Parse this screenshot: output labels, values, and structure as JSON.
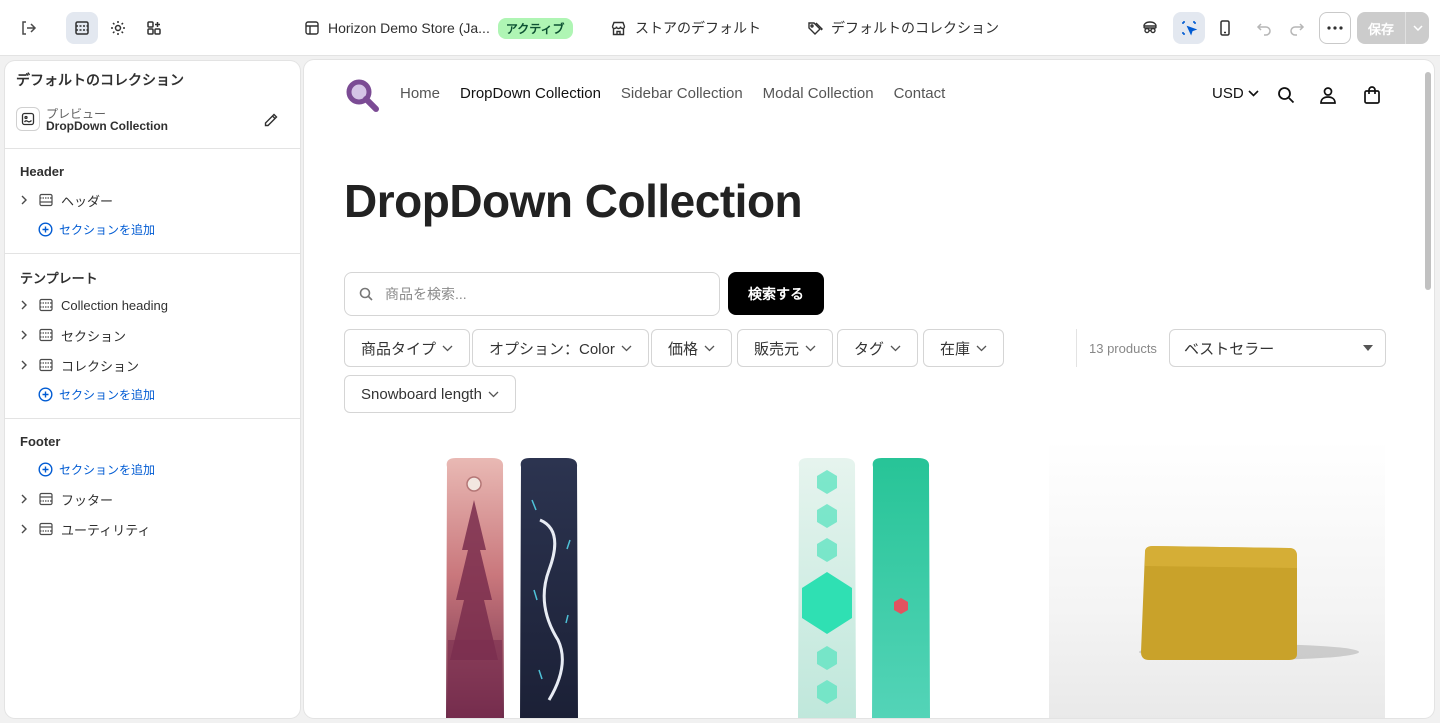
{
  "topbar": {
    "store_name": "Horizon Demo Store (Ja...",
    "store_status": "アクティブ",
    "store_default": "ストアのデフォルト",
    "collection_default": "デフォルトのコレクション",
    "save_label": "保存",
    "icons": [
      "exit-icon",
      "sections-icon",
      "gear-icon",
      "apps-icon",
      "inspect-icon",
      "selection-icon",
      "mobile-icon",
      "undo-icon",
      "redo-icon",
      "more-icon"
    ]
  },
  "sidebar": {
    "title": "デフォルトのコレクション",
    "preview_label": "プレビュー",
    "preview_value": "DropDown Collection",
    "header_group": {
      "title": "Header",
      "items": [
        "ヘッダー"
      ],
      "add_label": "セクションを追加"
    },
    "template_group": {
      "title": "テンプレート",
      "items": [
        "Collection heading",
        "セクション",
        "コレクション"
      ],
      "add_label": "セクションを追加"
    },
    "footer_group": {
      "title": "Footer",
      "add_label": "セクションを追加",
      "items": [
        "フッター",
        "ユーティリティ"
      ]
    }
  },
  "storefront": {
    "nav": [
      "Home",
      "DropDown Collection",
      "Sidebar Collection",
      "Modal Collection",
      "Contact"
    ],
    "currency": "USD",
    "page_title": "DropDown Collection",
    "search_placeholder": "商品を検索...",
    "search_button": "検索する",
    "filters": [
      "商品タイプ",
      "オプション：Color",
      "価格",
      "販売元",
      "タグ",
      "在庫",
      "Snowboard length"
    ],
    "product_count": "13 products",
    "sort_value": "ベストセラー"
  },
  "colors": {
    "accent": "#005bd3",
    "status_badge_bg": "#aff5b4",
    "logo_purple": "#7b4b94",
    "save_disabled": "#cccccc"
  }
}
